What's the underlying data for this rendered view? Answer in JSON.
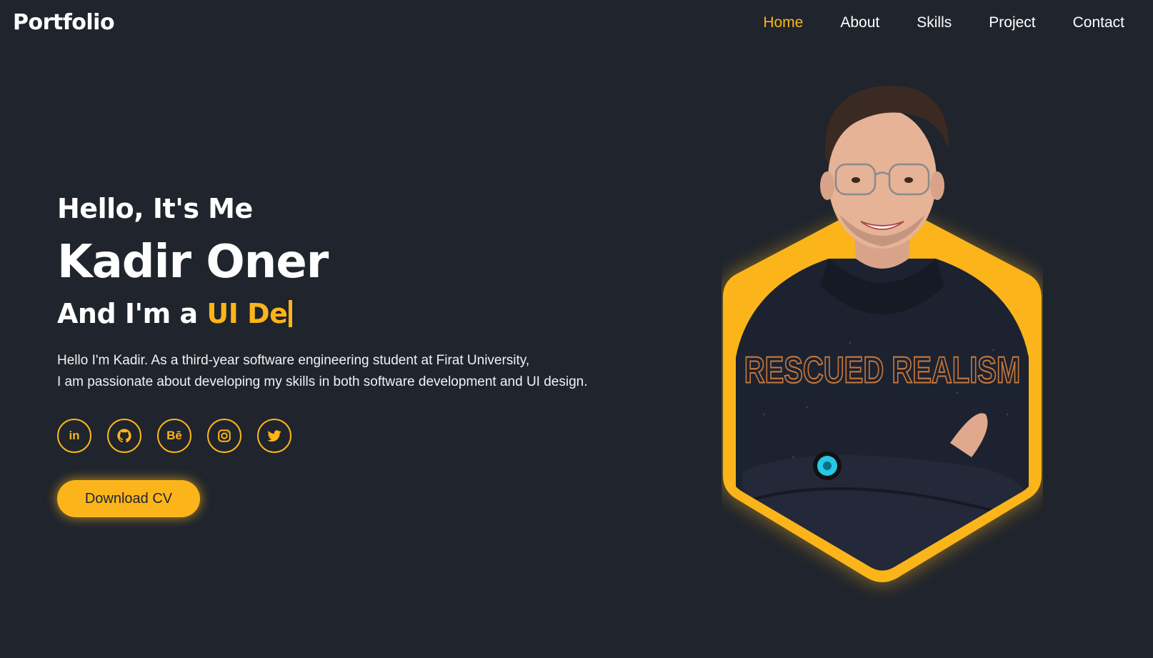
{
  "header": {
    "logo": "Portfolio",
    "nav": [
      "Home",
      "About",
      "Skills",
      "Project",
      "Contact"
    ],
    "active_index": 0
  },
  "hero": {
    "greeting": "Hello, It's Me",
    "name": "Kadir Oner",
    "role_prefix": "And I'm a ",
    "role_typed": "UI De",
    "bio_line1": "Hello I'm Kadir. As a third-year software engineering student at Firat University,",
    "bio_line2": "I am passionate about developing my skills in both software development and UI design.",
    "socials": [
      {
        "name": "linkedin-icon",
        "label": "in"
      },
      {
        "name": "github-icon",
        "label": ""
      },
      {
        "name": "behance-icon",
        "label": "Bē"
      },
      {
        "name": "instagram-icon",
        "label": ""
      },
      {
        "name": "twitter-icon",
        "label": ""
      }
    ],
    "cta_label": "Download CV"
  },
  "colors": {
    "background": "#1f242d",
    "accent": "#fbb51a",
    "text": "#ffffff"
  },
  "portrait": {
    "shirt_text": "RESCUED REALISM"
  }
}
